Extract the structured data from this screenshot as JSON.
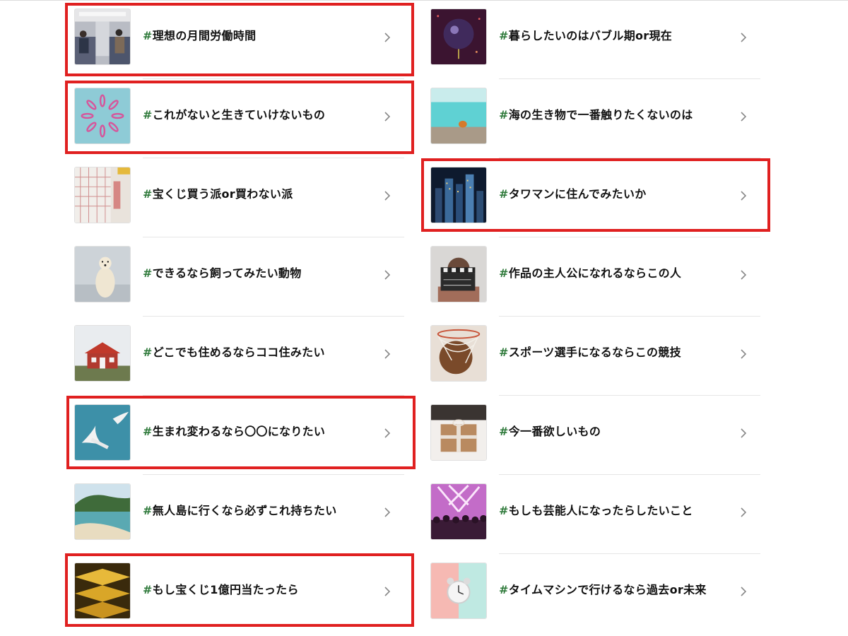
{
  "hash_symbol": "#",
  "colors": {
    "hash": "#2f7a3b",
    "highlight": "#e02020"
  },
  "left_items": [
    {
      "text": "理想の月間労働時間",
      "image": "train-commuters-image",
      "highlighted": true
    },
    {
      "text": "これがないと生きていけないもの",
      "image": "paper-clips-image",
      "highlighted": true
    },
    {
      "text": "宝くじ買う派or買わない派",
      "image": "lottery-ticket-image",
      "highlighted": false
    },
    {
      "text": "できるなら飼ってみたい動物",
      "image": "polar-bear-image",
      "highlighted": false
    },
    {
      "text": "どこでも住めるならココ住みたい",
      "image": "red-house-image",
      "highlighted": false
    },
    {
      "text": "生まれ変わるなら〇〇になりたい",
      "image": "seagulls-image",
      "highlighted": true
    },
    {
      "text": "無人島に行くなら必ずこれ持ちたい",
      "image": "island-beach-image",
      "highlighted": false
    },
    {
      "text": "もし宝くじ1億円当たったら",
      "image": "gold-bars-image",
      "highlighted": true
    }
  ],
  "right_items": [
    {
      "text": "暮らしたいのはバブル期or現在",
      "image": "disco-ball-image",
      "highlighted": false
    },
    {
      "text": "海の生き物で一番触りたくないのは",
      "image": "hermit-crab-image",
      "highlighted": false
    },
    {
      "text": "タワマンに住んでみたいか",
      "image": "city-night-image",
      "highlighted": true
    },
    {
      "text": "作品の主人公になれるならこの人",
      "image": "clapperboard-image",
      "highlighted": false
    },
    {
      "text": "スポーツ選手になるならこの競技",
      "image": "basketball-hoop-image",
      "highlighted": false
    },
    {
      "text": "今一番欲しいもの",
      "image": "gift-box-image",
      "highlighted": false
    },
    {
      "text": "もしも芸能人になったらしたいこと",
      "image": "concert-crowd-image",
      "highlighted": false
    },
    {
      "text": "タイムマシンで行けるなら過去or未来",
      "image": "alarm-clock-image",
      "highlighted": false
    }
  ]
}
